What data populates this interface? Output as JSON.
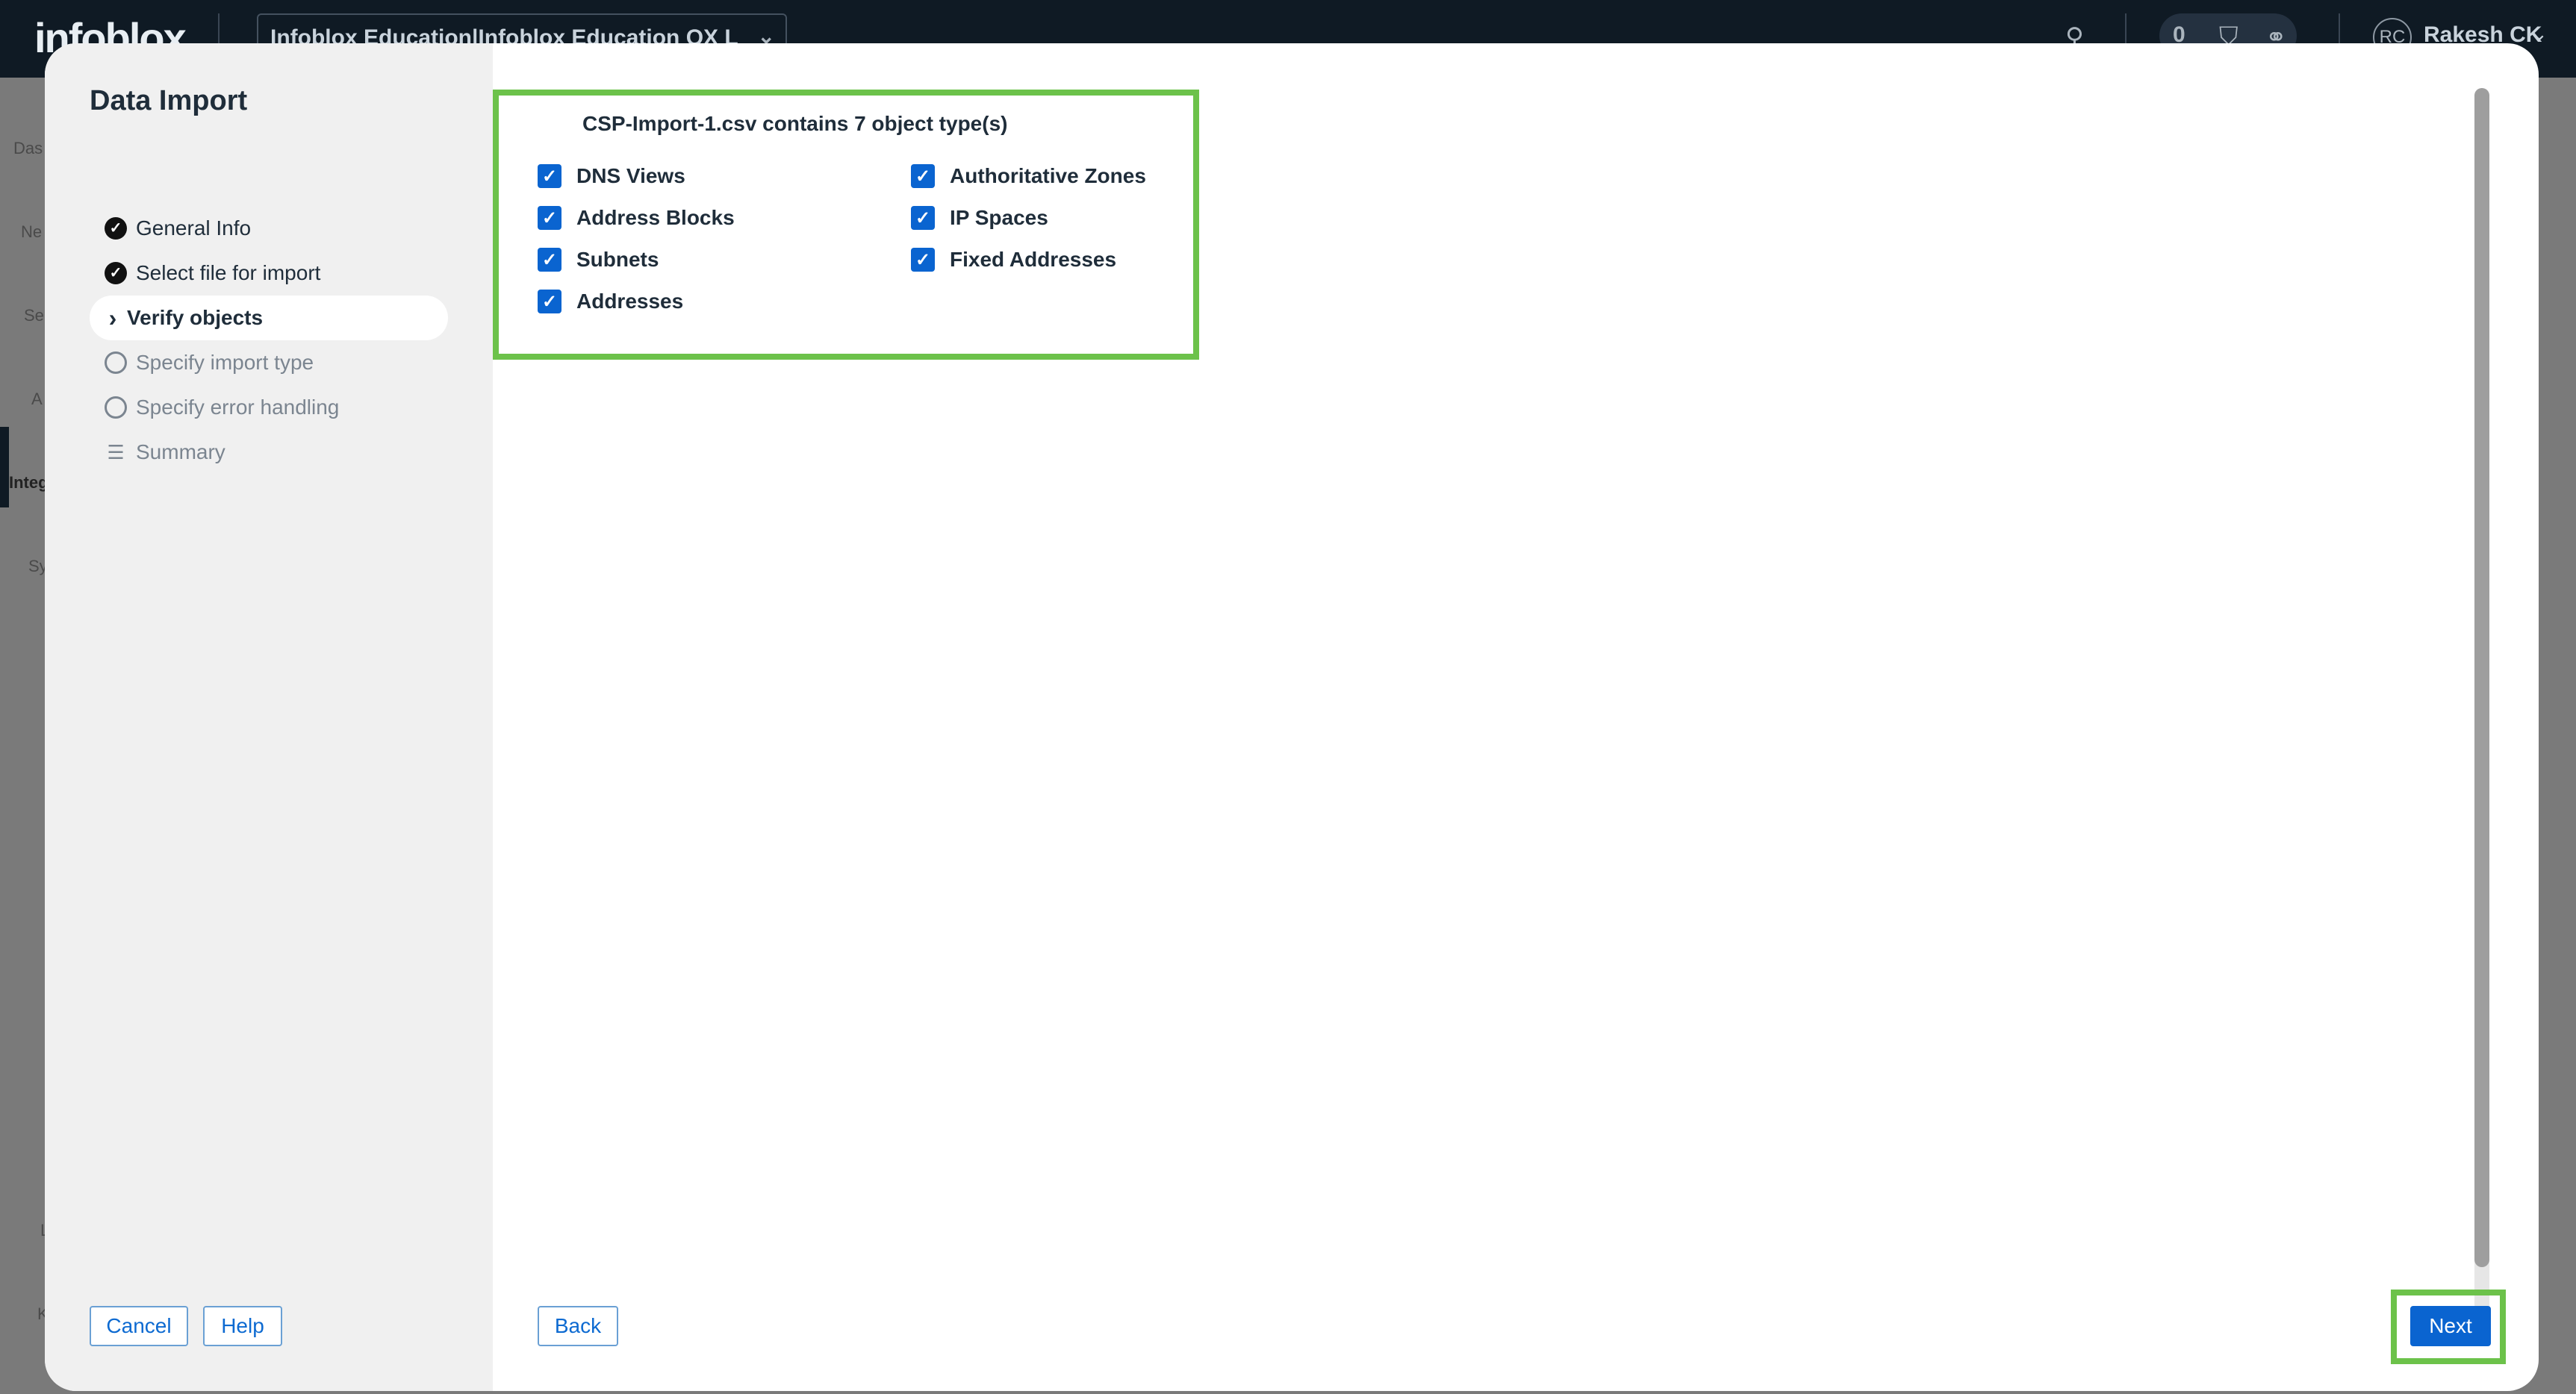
{
  "app": {
    "brand": "infoblox",
    "org_selector": "Infoblox Education|Infoblox Education QX L",
    "notification_count": "0",
    "user_initials": "RC",
    "user_name": "Rakesh CK"
  },
  "background_sidebar": [
    "Das",
    "Ne",
    "Se",
    "A",
    "Integ",
    "Sy",
    "L",
    "K"
  ],
  "modal": {
    "title": "Data Import",
    "steps": [
      {
        "label": "General Info",
        "status": "complete"
      },
      {
        "label": "Select file for import",
        "status": "complete"
      },
      {
        "label": "Verify objects",
        "status": "active"
      },
      {
        "label": "Specify import type",
        "status": "pending"
      },
      {
        "label": "Specify error handling",
        "status": "pending"
      },
      {
        "label": "Summary",
        "status": "pending"
      }
    ],
    "cancel_label": "Cancel",
    "help_label": "Help",
    "back_label": "Back",
    "next_label": "Next"
  },
  "verify": {
    "heading": "CSP-Import-1.csv contains 7 object type(s)",
    "objects": [
      {
        "label": "DNS Views",
        "checked": true
      },
      {
        "label": "Address Blocks",
        "checked": true
      },
      {
        "label": "Subnets",
        "checked": true
      },
      {
        "label": "Addresses",
        "checked": true
      },
      {
        "label": "Authoritative Zones",
        "checked": true
      },
      {
        "label": "IP Spaces",
        "checked": true
      },
      {
        "label": "Fixed Addresses",
        "checked": true
      }
    ]
  },
  "colors": {
    "primary": "#0a64d0",
    "highlight": "#6cc24a",
    "topbar": "#0f1a24"
  }
}
